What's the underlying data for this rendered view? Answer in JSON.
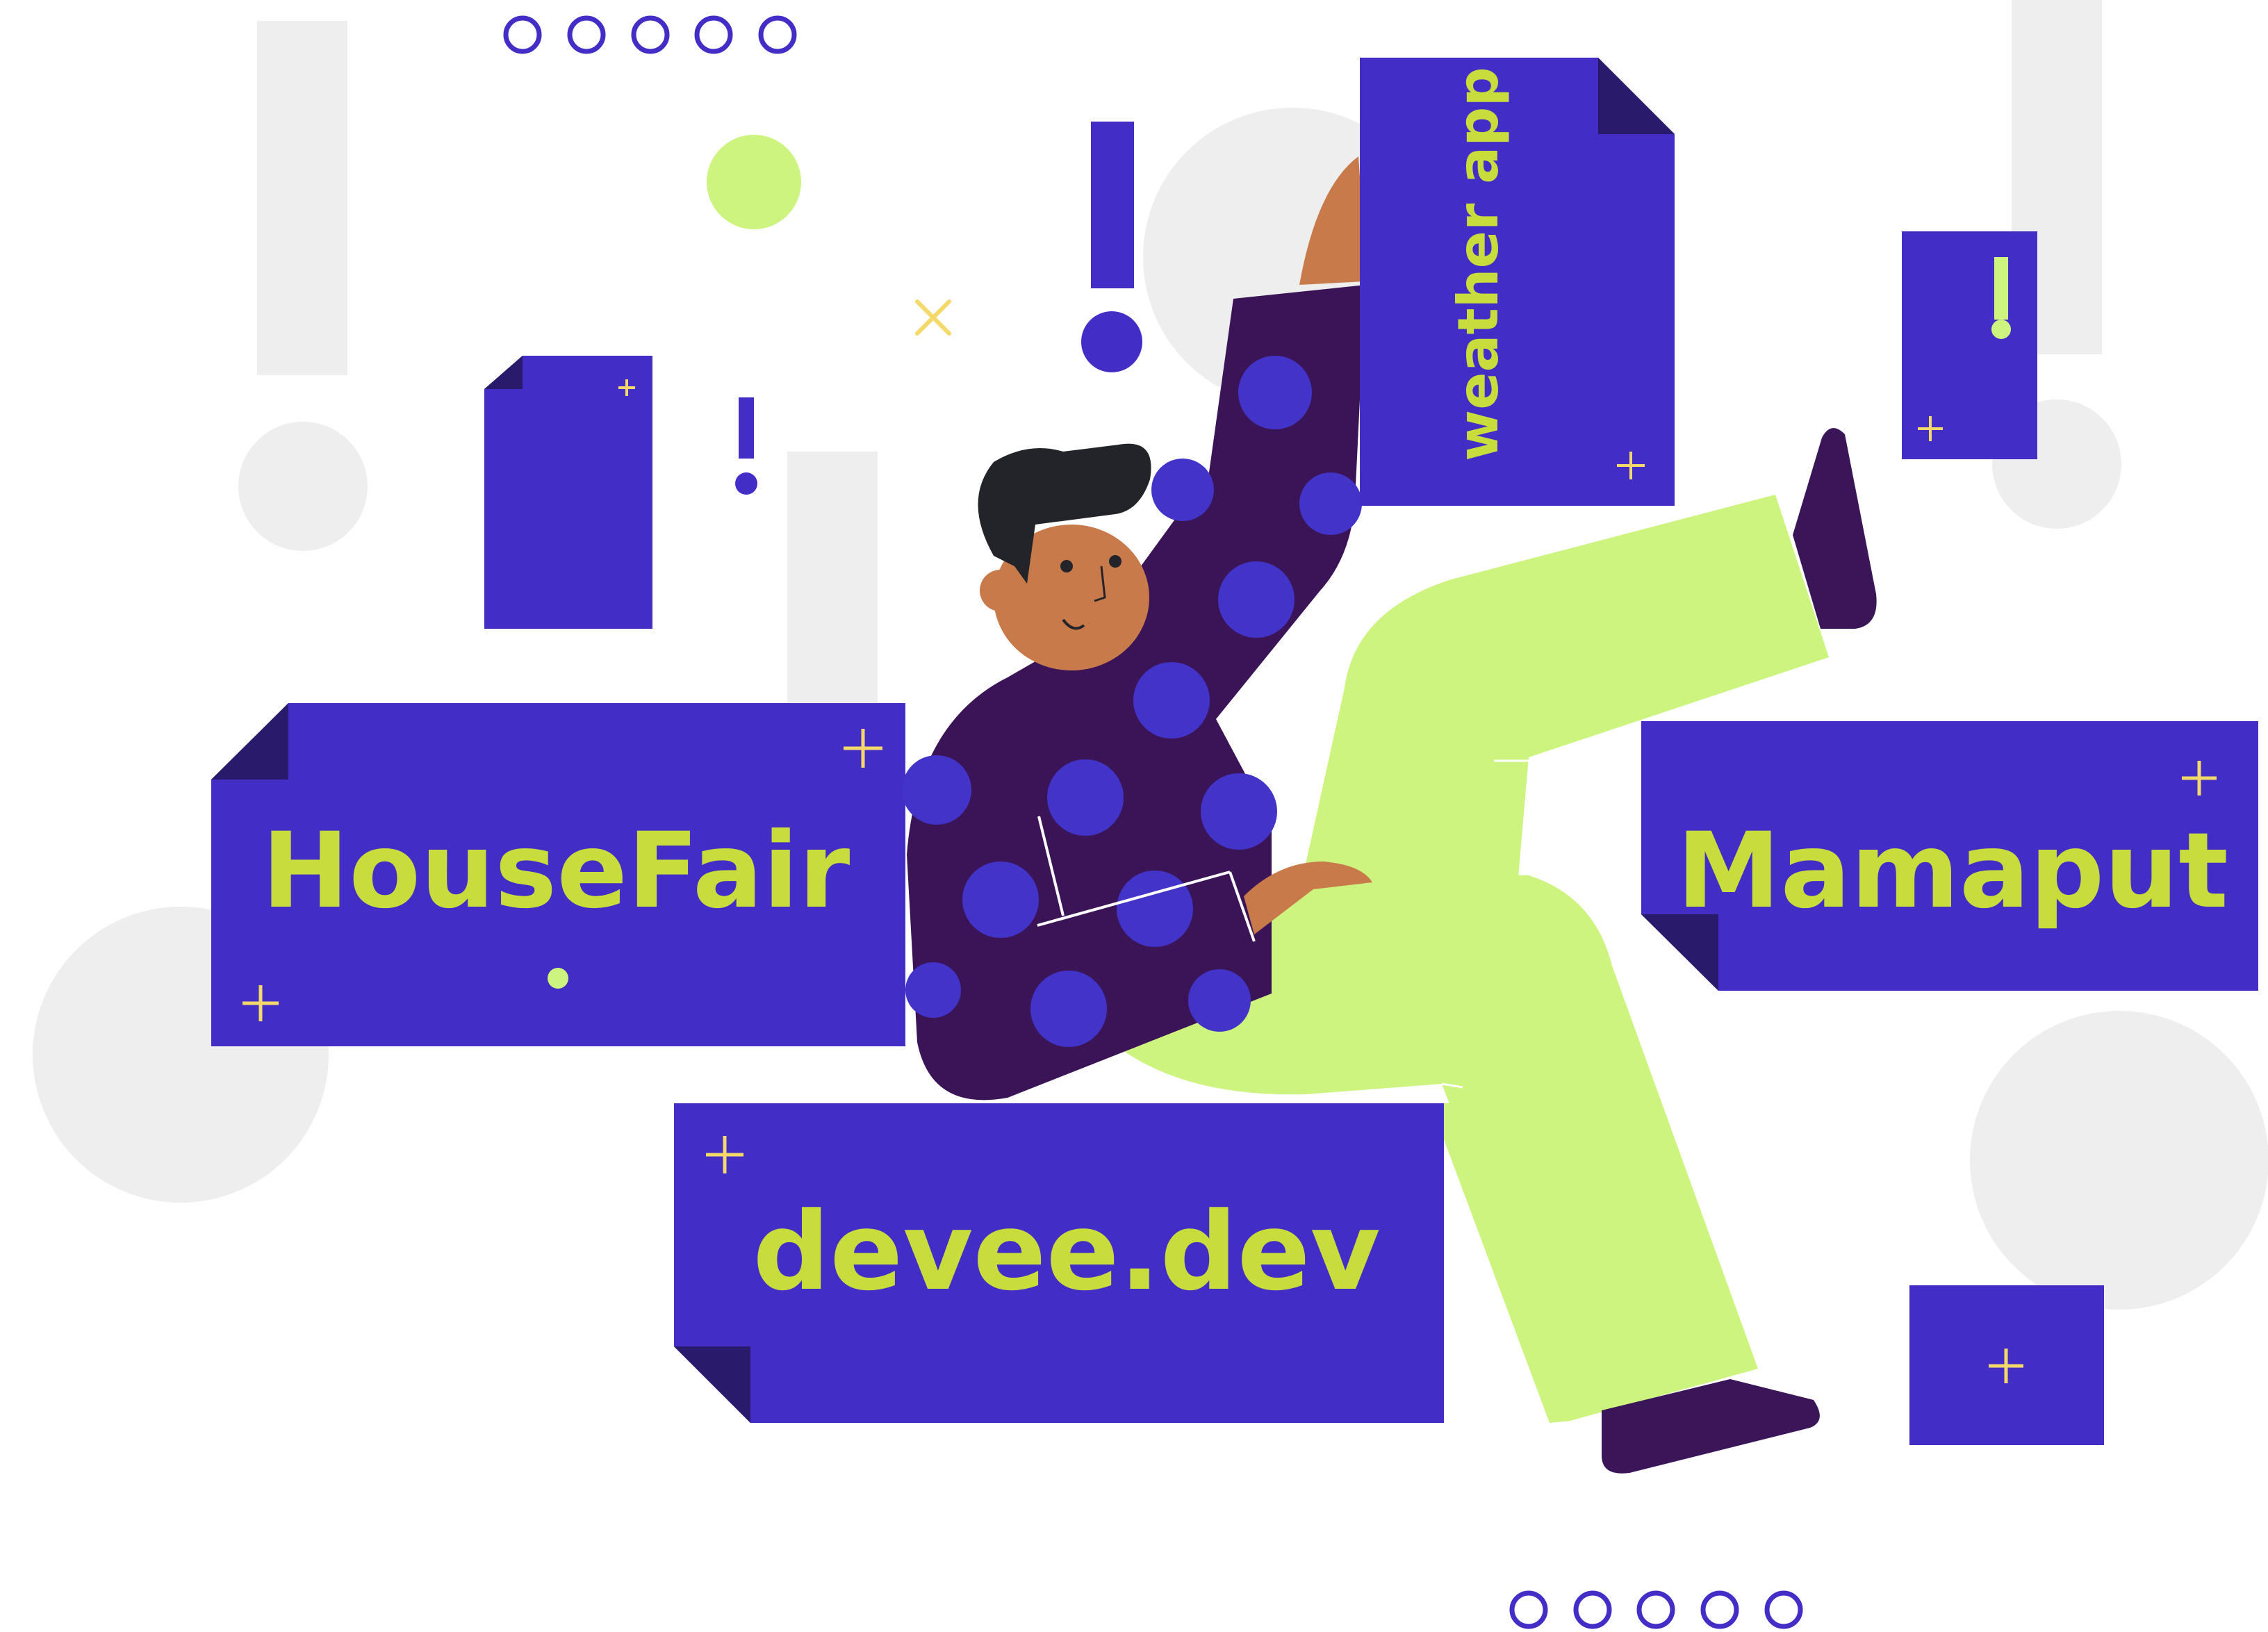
{
  "colors": {
    "background": "#ffffff",
    "card": "#422ec6",
    "card_fold": "#2a1a6b",
    "text_accent": "#c8dc3c",
    "lime": "#cdf47e",
    "shirt": "#3b1458",
    "shirt_dots": "#4233c9",
    "skin": "#c97a4b",
    "hair": "#23242a",
    "shoes": "#3a1558",
    "gray_shape": "#eeeeee",
    "yellow_plus": "#f4d96a"
  },
  "cards": {
    "housefair": "HouseFair",
    "mamaput": "Mamaput",
    "devee": "devee.dev",
    "weather": "weather app"
  },
  "icons": {
    "exclamation": "exclamation-icon",
    "plus": "plus-icon",
    "cross": "cross-icon",
    "dot_row": "ring-dots"
  }
}
